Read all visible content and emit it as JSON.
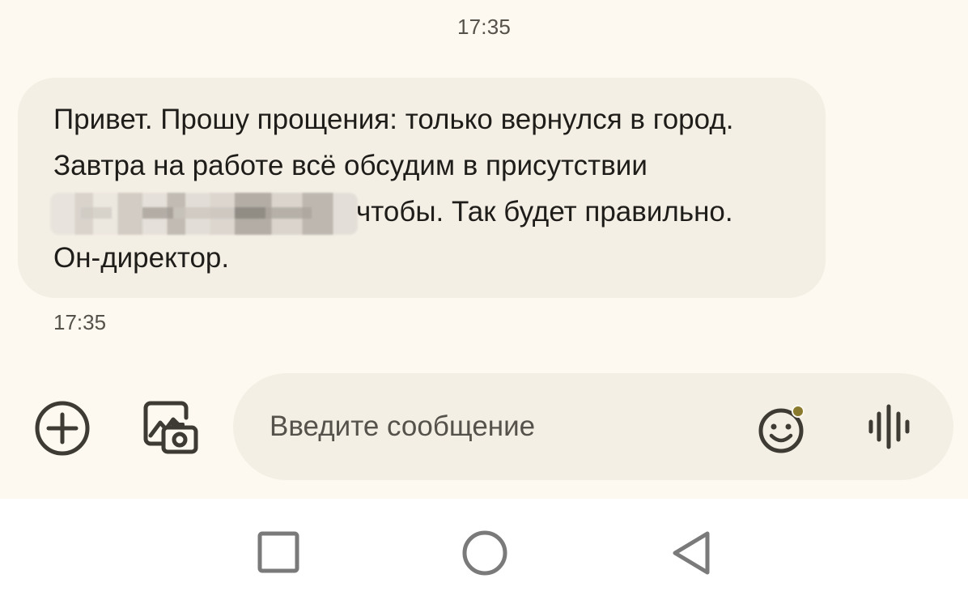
{
  "chat": {
    "top_timestamp": "17:35",
    "message": {
      "line1": "Привет. Прошу прощения: только вернулся в город.",
      "line2": "Завтра на работе всё обсудим в присутствии",
      "line3_visible": "чтобы. Так будет правильно.",
      "line4": "Он-директор.",
      "timestamp": "17:35"
    }
  },
  "composer": {
    "placeholder": "Введите сообщение",
    "icons": [
      "plus-circle-icon",
      "gallery-camera-icon",
      "emoji-icon",
      "voice-wave-icon"
    ],
    "emoji_badge_color": "#8a7a2e"
  },
  "navbar": {
    "icons": [
      "recents-square-icon",
      "home-circle-icon",
      "back-triangle-icon"
    ]
  },
  "colors": {
    "background": "#fdf9f0",
    "bubble": "#f4efe5",
    "icon": "#3d3b33",
    "nav_icon": "#7a7a7a"
  }
}
